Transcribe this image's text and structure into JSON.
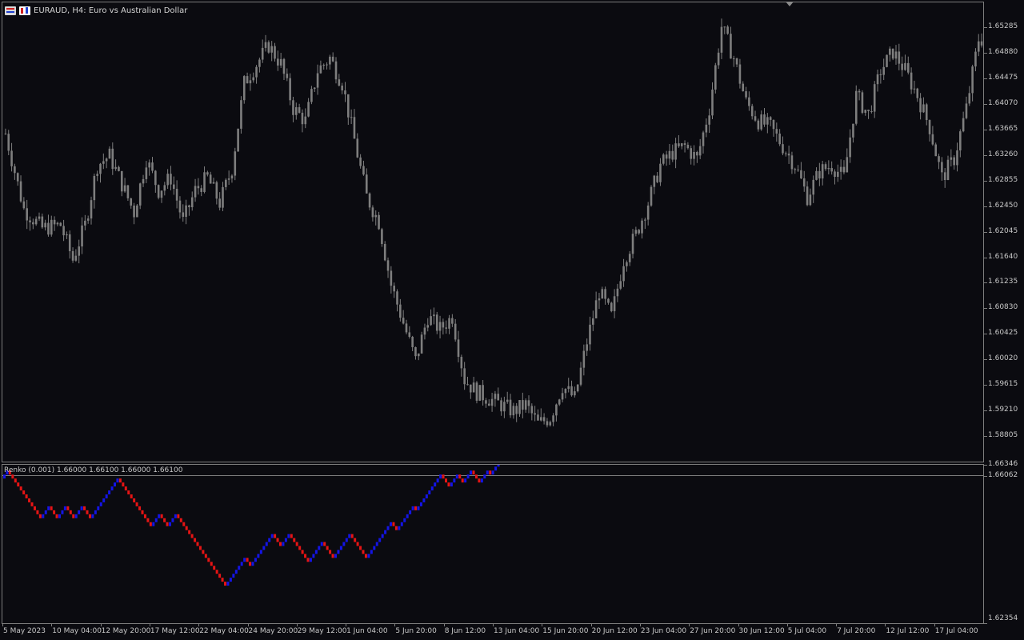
{
  "header": {
    "title": "EURAUD, H4:  Euro vs Australian Dollar"
  },
  "indicator": {
    "label": "Renko (0.001) 1.66000 1.66100 1.66000 1.66100"
  },
  "colors": {
    "background": "#0b0b10",
    "candle": "#7e7e7e",
    "renko_up": "#1414e6",
    "renko_down": "#e61414",
    "axis": "#7d7d7d",
    "text": "#c8c8c8"
  },
  "icons": [
    "chart-type-icon",
    "one-click-trading-icon"
  ],
  "chart_data": [
    {
      "type": "candlestick",
      "title": "EURAUD, H4:  Euro vs Australian Dollar",
      "ylim": [
        1.584,
        1.6568
      ],
      "y_ticks": [
        "1.65285",
        "1.64880",
        "1.64475",
        "1.64070",
        "1.63665",
        "1.63260",
        "1.62855",
        "1.62450",
        "1.62045",
        "1.61640",
        "1.61235",
        "1.60830",
        "1.60425",
        "1.60020",
        "1.59615",
        "1.59210",
        "1.58805"
      ],
      "x_labels": [
        "5 May 2023",
        "10 May 04:00",
        "12 May 20:00",
        "17 May 12:00",
        "22 May 04:00",
        "24 May 20:00",
        "29 May 12:00",
        "1 Jun 04:00",
        "5 Jun 20:00",
        "8 Jun 12:00",
        "13 Jun 04:00",
        "15 Jun 20:00",
        "20 Jun 12:00",
        "23 Jun 04:00",
        "27 Jun 20:00",
        "30 Jun 12:00",
        "5 Jul 04:00",
        "7 Jul 20:00",
        "12 Jul 12:00",
        "17 Jul 04:00"
      ],
      "close_path": [
        [
          0,
          1.636
        ],
        [
          6,
          1.624
        ],
        [
          12,
          1.621
        ],
        [
          18,
          1.6215
        ],
        [
          22,
          1.616
        ],
        [
          26,
          1.6215
        ],
        [
          30,
          1.631
        ],
        [
          34,
          1.6325
        ],
        [
          38,
          1.628
        ],
        [
          42,
          1.6235
        ],
        [
          46,
          1.632
        ],
        [
          50,
          1.627
        ],
        [
          54,
          1.629
        ],
        [
          58,
          1.622
        ],
        [
          62,
          1.627
        ],
        [
          66,
          1.629
        ],
        [
          70,
          1.625
        ],
        [
          74,
          1.6305
        ],
        [
          78,
          1.644
        ],
        [
          82,
          1.647
        ],
        [
          86,
          1.65
        ],
        [
          90,
          1.647
        ],
        [
          94,
          1.64
        ],
        [
          98,
          1.638
        ],
        [
          102,
          1.646
        ],
        [
          106,
          1.648
        ],
        [
          110,
          1.644
        ],
        [
          114,
          1.635
        ],
        [
          118,
          1.626
        ],
        [
          122,
          1.622
        ],
        [
          126,
          1.612
        ],
        [
          130,
          1.606
        ],
        [
          134,
          1.6
        ],
        [
          138,
          1.607
        ],
        [
          142,
          1.605
        ],
        [
          146,
          1.607
        ],
        [
          150,
          1.597
        ],
        [
          154,
          1.595
        ],
        [
          158,
          1.594
        ],
        [
          162,
          1.593
        ],
        [
          166,
          1.592
        ],
        [
          170,
          1.593
        ],
        [
          174,
          1.59
        ],
        [
          178,
          1.591
        ],
        [
          182,
          1.596
        ],
        [
          186,
          1.594
        ],
        [
          190,
          1.603
        ],
        [
          194,
          1.611
        ],
        [
          198,
          1.607
        ],
        [
          202,
          1.616
        ],
        [
          206,
          1.62
        ],
        [
          210,
          1.625
        ],
        [
          214,
          1.631
        ],
        [
          218,
          1.633
        ],
        [
          222,
          1.634
        ],
        [
          226,
          1.632
        ],
        [
          230,
          1.64
        ],
        [
          234,
          1.653
        ],
        [
          238,
          1.648
        ],
        [
          242,
          1.641
        ],
        [
          246,
          1.638
        ],
        [
          250,
          1.637
        ],
        [
          254,
          1.634
        ],
        [
          258,
          1.631
        ],
        [
          262,
          1.626
        ],
        [
          266,
          1.63
        ],
        [
          270,
          1.631
        ],
        [
          274,
          1.629
        ],
        [
          278,
          1.642
        ],
        [
          282,
          1.639
        ],
        [
          286,
          1.646
        ],
        [
          290,
          1.649
        ],
        [
          294,
          1.646
        ],
        [
          298,
          1.642
        ],
        [
          302,
          1.637
        ],
        [
          306,
          1.629
        ],
        [
          310,
          1.632
        ],
        [
          314,
          1.64
        ],
        [
          318,
          1.651
        ]
      ]
    },
    {
      "type": "renko",
      "name": "Renko (0.001)",
      "ylim": [
        1.62354,
        1.66346
      ],
      "y_ticks": [
        "1.66346",
        "1.66062",
        "1.62354"
      ],
      "box_size": 0.001,
      "legs": [
        2,
        -12,
        3,
        -3,
        3,
        -3,
        3,
        -3,
        10,
        -12,
        3,
        -3,
        3,
        -18,
        7,
        -2,
        8,
        -3,
        3,
        -7,
        5,
        -4,
        6,
        -6,
        9,
        -2,
        6,
        -1,
        8,
        1,
        -3,
        3,
        -2,
        3,
        -3,
        3,
        -1,
        4,
        -1,
        3,
        -3,
        3,
        -3
      ]
    }
  ]
}
